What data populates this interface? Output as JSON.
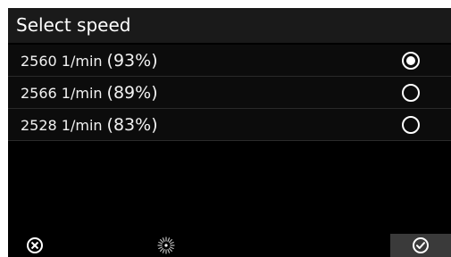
{
  "header": {
    "title": "Select speed"
  },
  "options": [
    {
      "speed": "2560 1/min",
      "percent": "(93%)",
      "selected": true
    },
    {
      "speed": "2566 1/min",
      "percent": "(89%)",
      "selected": false
    },
    {
      "speed": "2528 1/min",
      "percent": "(83%)",
      "selected": false
    }
  ],
  "footer": {
    "cancel_icon": "cancel-icon",
    "busy_icon": "loading-spinner-icon",
    "confirm_icon": "check-icon"
  },
  "colors": {
    "background": "#000000",
    "header_background": "#1a1a1a",
    "confirm_background": "#3a3a3a",
    "text": "#ffffff"
  }
}
